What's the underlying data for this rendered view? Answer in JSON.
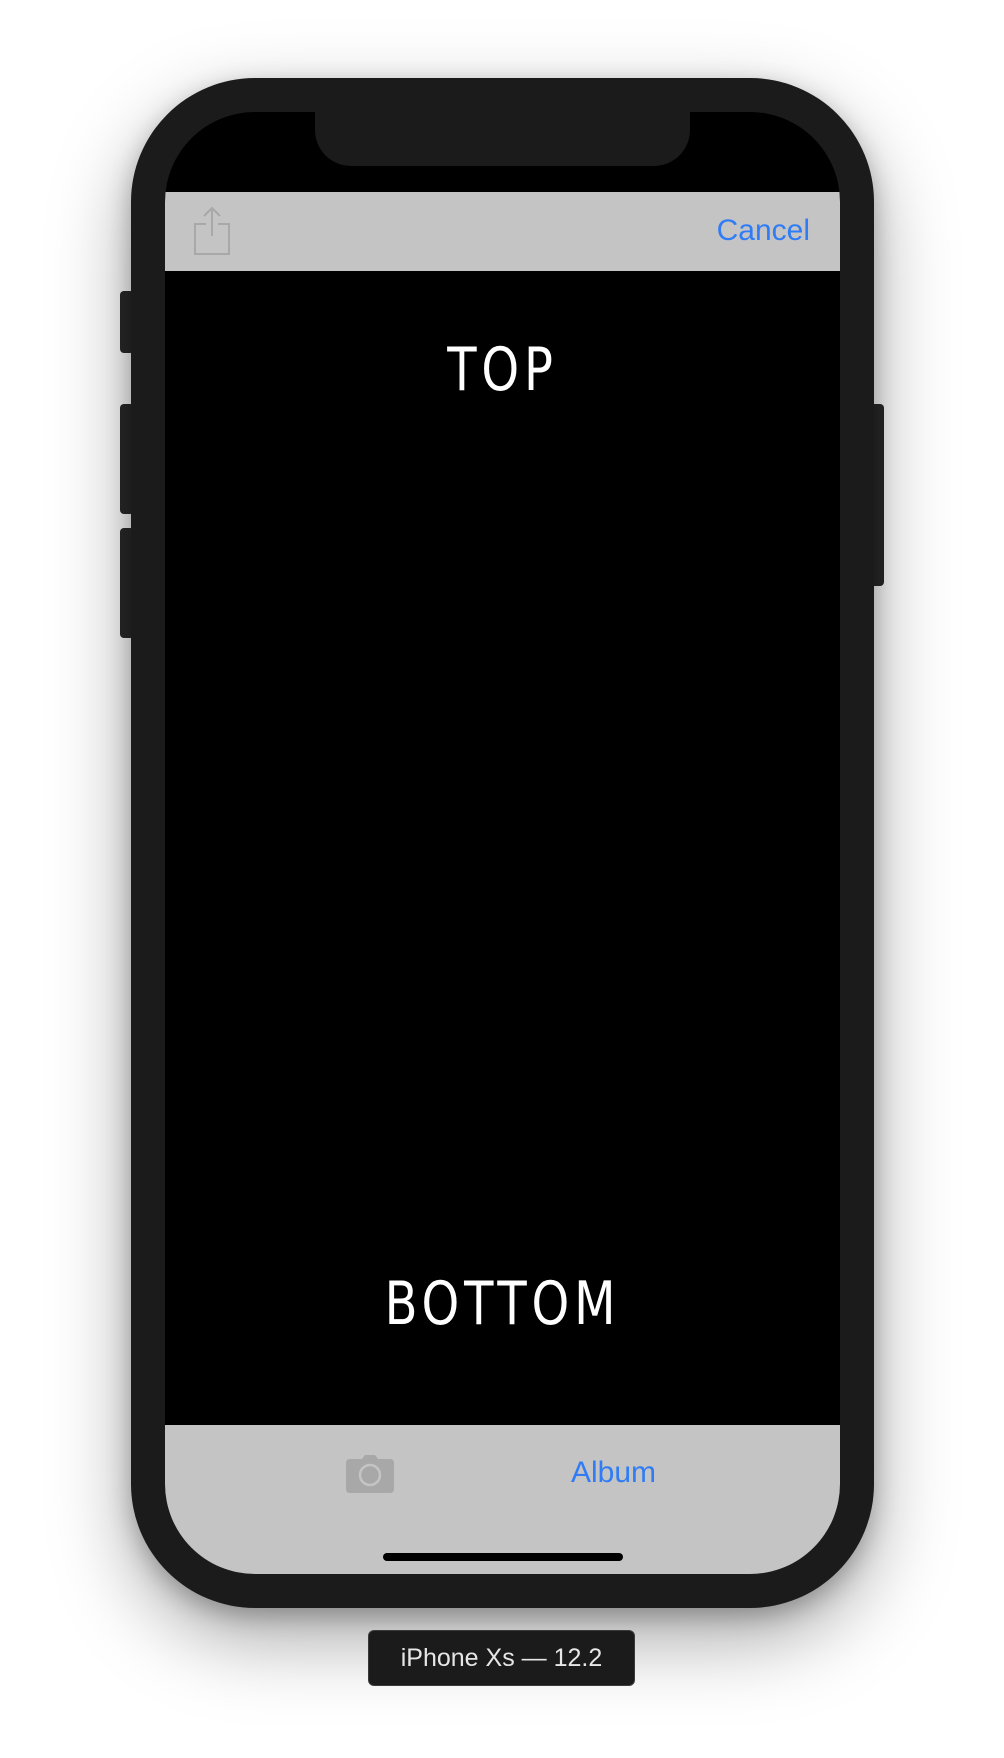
{
  "window": {
    "device_label": "iPhone Xs — 12.2"
  },
  "toolbar": {
    "share_icon": "share-icon",
    "cancel_label": "Cancel"
  },
  "meme": {
    "top_text": "TOP",
    "bottom_text": "BOTTOM"
  },
  "bottom_toolbar": {
    "camera_icon": "camera-icon",
    "album_label": "Album"
  },
  "colors": {
    "accent": "#2f7cf6",
    "toolbar_bg": "#c4c4c4",
    "device_frame": "#1b1b1b",
    "disabled_icon": "#a8a8a8"
  }
}
